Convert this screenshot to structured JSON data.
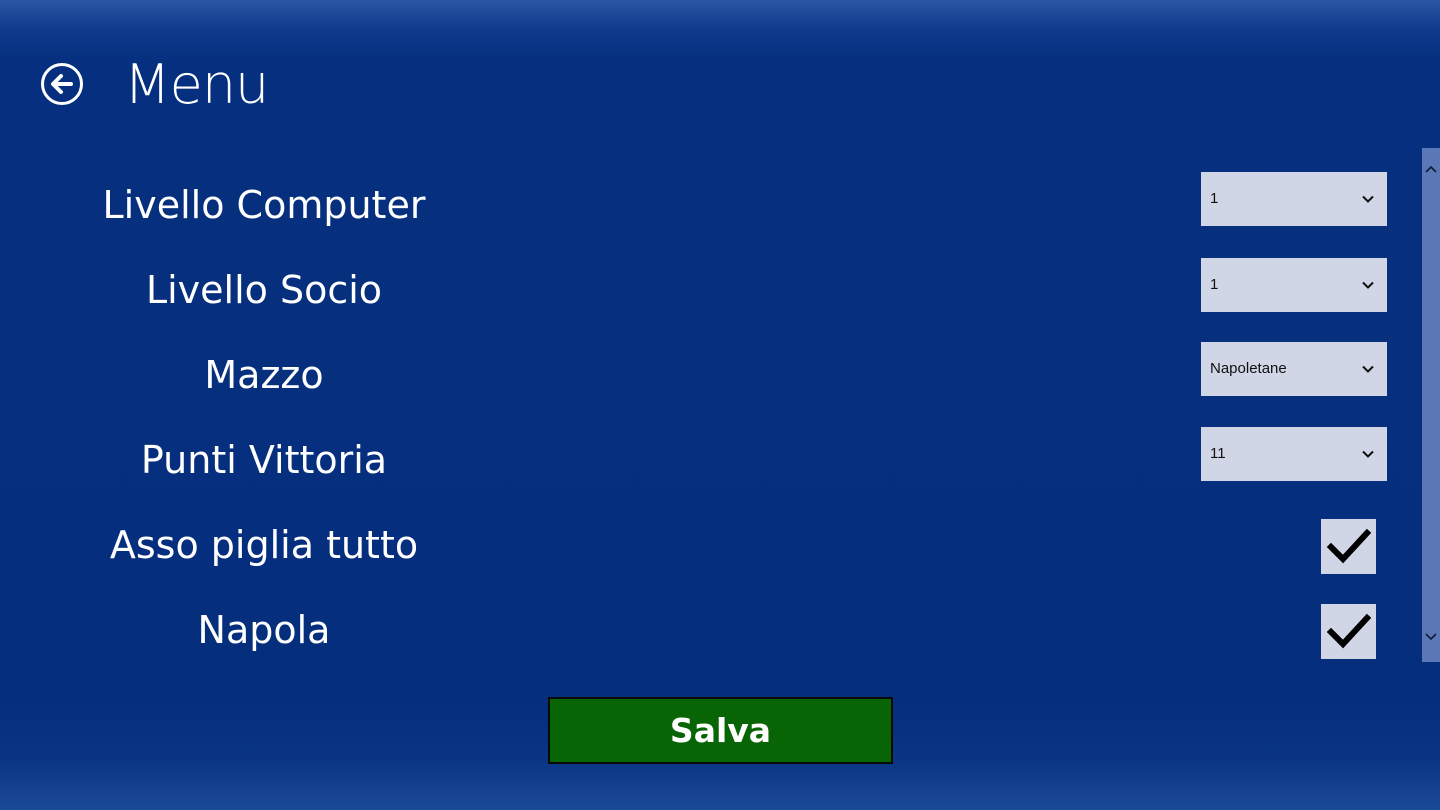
{
  "header": {
    "title": "Menu",
    "back_icon": "arrow-left-circle-icon"
  },
  "settings": [
    {
      "label": "Livello Computer",
      "type": "select",
      "value": "1"
    },
    {
      "label": "Livello Socio",
      "type": "select",
      "value": "1"
    },
    {
      "label": "Mazzo",
      "type": "select",
      "value": "Napoletane"
    },
    {
      "label": "Punti Vittoria",
      "type": "select",
      "value": "11"
    },
    {
      "label": "Asso piglia tutto",
      "type": "checkbox",
      "checked": true
    },
    {
      "label": "Napola",
      "type": "checkbox",
      "checked": true
    }
  ],
  "save_label": "Salva",
  "colors": {
    "background": "#062f80",
    "control_bg": "#d0d6e6",
    "save_bg": "#076506",
    "scrollbar": "#5b78b6"
  }
}
